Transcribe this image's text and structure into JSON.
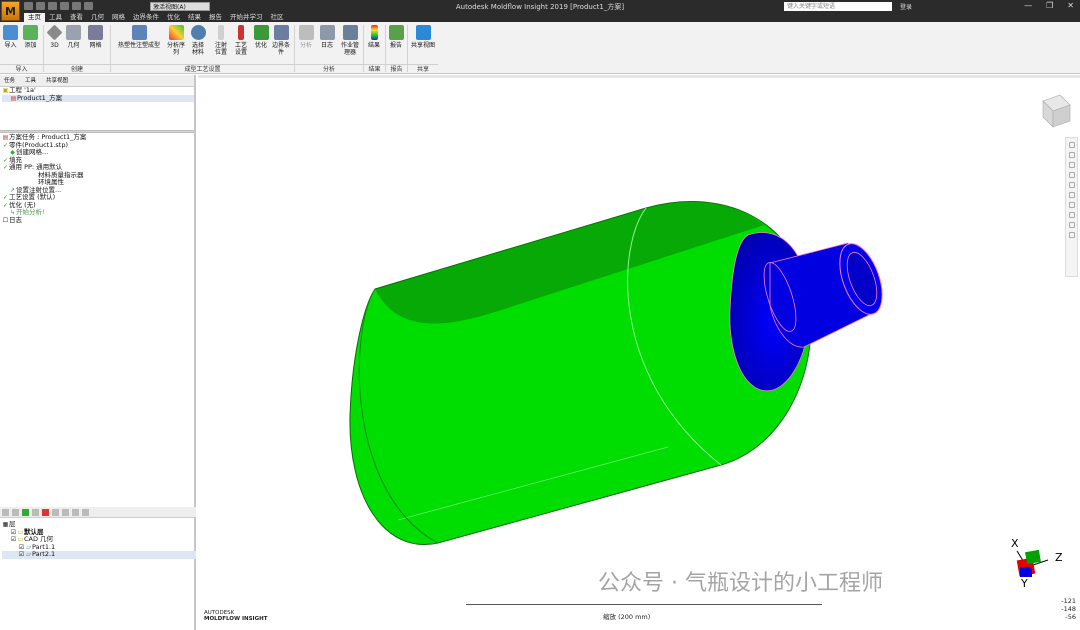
{
  "window": {
    "title": "Autodesk Moldflow Insight 2019    [Product1_方案]",
    "view_select": "激活视图(A)",
    "search_placeholder": "键入关键字或短语",
    "login": "登录",
    "controls": [
      "—",
      "❐",
      "✕"
    ]
  },
  "menu": {
    "tabs": [
      "主页",
      "工具",
      "查看",
      "几何",
      "网格",
      "边界条件",
      "优化",
      "结果",
      "报告",
      "开始并学习",
      "社区"
    ]
  },
  "ribbon": {
    "buttons": [
      {
        "label": "导入",
        "icon": "import-icon"
      },
      {
        "label": "添加",
        "icon": "add-icon"
      },
      {
        "label": "3D",
        "icon": "3d-icon"
      },
      {
        "label": "几何",
        "icon": "geometry-icon"
      },
      {
        "label": "网格",
        "icon": "mesh-icon"
      },
      {
        "label": "热塑性注塑成型",
        "icon": "molding-process-icon"
      },
      {
        "label": "分析序列",
        "icon": "analysis-sequence-icon"
      },
      {
        "label": "选择材料",
        "icon": "select-material-icon"
      },
      {
        "label": "注射位置",
        "icon": "injection-location-icon"
      },
      {
        "label": "工艺设置",
        "icon": "process-settings-icon"
      },
      {
        "label": "优化",
        "icon": "optimize-icon"
      },
      {
        "label": "边界条件",
        "icon": "boundary-conditions-icon"
      },
      {
        "label": "分析",
        "icon": "analyze-icon"
      },
      {
        "label": "日志",
        "icon": "log-icon"
      },
      {
        "label": "作业管理器",
        "icon": "job-manager-icon"
      },
      {
        "label": "结果",
        "icon": "results-icon"
      },
      {
        "label": "报告",
        "icon": "report-icon"
      },
      {
        "label": "共享视图",
        "icon": "share-view-icon"
      }
    ],
    "groups": [
      "导入",
      "创建",
      "成型工艺设置",
      "分析",
      "结果",
      "报告",
      "共享"
    ]
  },
  "project_panel": {
    "tabs": [
      "任务",
      "工具",
      "共享视图"
    ],
    "project": "工程 '1a'",
    "study": "Product1_方案"
  },
  "study_tasks": [
    "方案任务 : Product1_方案",
    "零件(Product1.stp)",
    "创建网格...",
    "填充",
    "通用 PP: 通用默认",
    "材料质量指示器",
    "环境属性",
    "设置注射位置...",
    "工艺设置 (默认)",
    "优化 (无)",
    "开始分析!",
    "日志"
  ],
  "layers": {
    "root": "层",
    "items": [
      "默认层",
      "CAD 几何",
      "Part1.1",
      "Part2.1"
    ]
  },
  "viewport": {
    "brand_line1": "AUTODESK",
    "brand_line2": "MOLDFLOW INSIGHT",
    "scale_label": "缩放 (200 mm)",
    "coords": [
      "-121",
      "-148",
      "-56"
    ],
    "axis_labels": [
      "X",
      "Y",
      "Z"
    ],
    "watermark": "公众号 · 气瓶设计的小工程师"
  },
  "colors": {
    "body": "#00e000",
    "neck": "#0000e6",
    "edge": "#ff7ad0"
  }
}
